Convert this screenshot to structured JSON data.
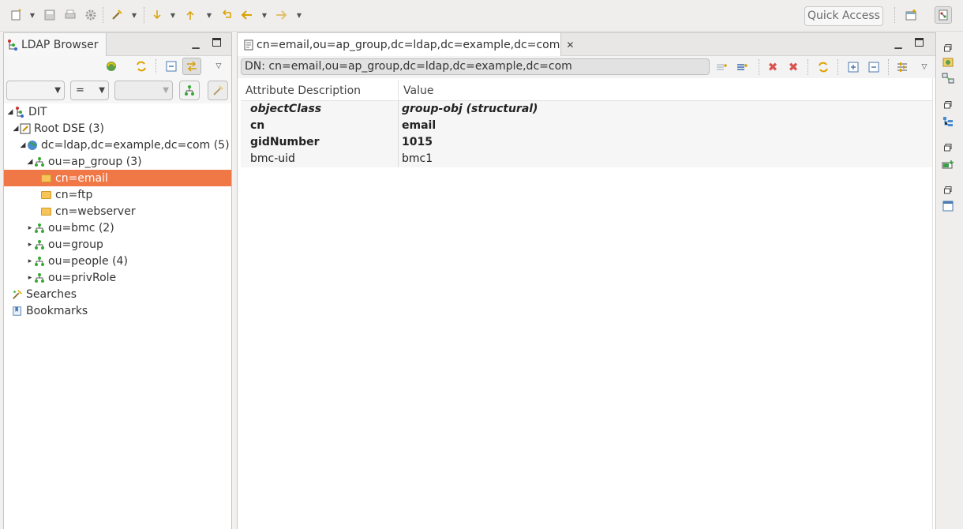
{
  "toolbar": {
    "icons": [
      "new-icon",
      "save-icon",
      "print-icon",
      "gear-icon",
      "wand-icon",
      "next-annotation-icon",
      "previous-annotation-icon",
      "last-edit-icon",
      "back-icon",
      "forward-icon"
    ],
    "quick_access": "Quick Access"
  },
  "left_panel": {
    "tab_title": "LDAP Browser",
    "filter": {
      "attribute": "",
      "operator": "=",
      "value": ""
    },
    "tree": [
      {
        "label": "DIT",
        "level": 0,
        "expanded": true,
        "icon": "dit-icon"
      },
      {
        "label": "Root DSE (3)",
        "level": 1,
        "expanded": true,
        "icon": "root-dse-icon"
      },
      {
        "label": "dc=ldap,dc=example,dc=com (5)",
        "level": 2,
        "expanded": true,
        "icon": "globe-icon"
      },
      {
        "label": "ou=ap_group (3)",
        "level": 3,
        "expanded": true,
        "icon": "ou-icon"
      },
      {
        "label": "cn=email",
        "level": 4,
        "selected": true,
        "icon": "folder-icon"
      },
      {
        "label": "cn=ftp",
        "level": 4,
        "icon": "folder-icon"
      },
      {
        "label": "cn=webserver",
        "level": 4,
        "icon": "folder-icon"
      },
      {
        "label": "ou=bmc (2)",
        "level": 3,
        "expanded": false,
        "icon": "ou-icon"
      },
      {
        "label": "ou=group",
        "level": 3,
        "expanded": false,
        "icon": "ou-icon"
      },
      {
        "label": "ou=people (4)",
        "level": 3,
        "expanded": false,
        "icon": "ou-icon"
      },
      {
        "label": "ou=privRole",
        "level": 3,
        "expanded": false,
        "icon": "ou-icon"
      },
      {
        "label": "Searches",
        "level": 0,
        "icon": "searches-icon"
      },
      {
        "label": "Bookmarks",
        "level": 0,
        "icon": "bookmarks-icon"
      }
    ]
  },
  "editor": {
    "tab_title": "cn=email,ou=ap_group,dc=ldap,dc=example,dc=com",
    "dn": "DN: cn=email,ou=ap_group,dc=ldap,dc=example,dc=com",
    "columns": [
      "Attribute Description",
      "Value"
    ],
    "rows": [
      {
        "attribute": "objectClass",
        "value": "group-obj (structural)",
        "style": "bold-italic"
      },
      {
        "attribute": "cn",
        "value": "email",
        "style": "bold"
      },
      {
        "attribute": "gidNumber",
        "value": "1015",
        "style": "bold"
      },
      {
        "attribute": "bmc-uid",
        "value": "bmc1",
        "style": "normal"
      }
    ]
  },
  "colors": {
    "selection": "#f07746",
    "background": "#f2f1f0",
    "delete_red": "#d9534f"
  }
}
